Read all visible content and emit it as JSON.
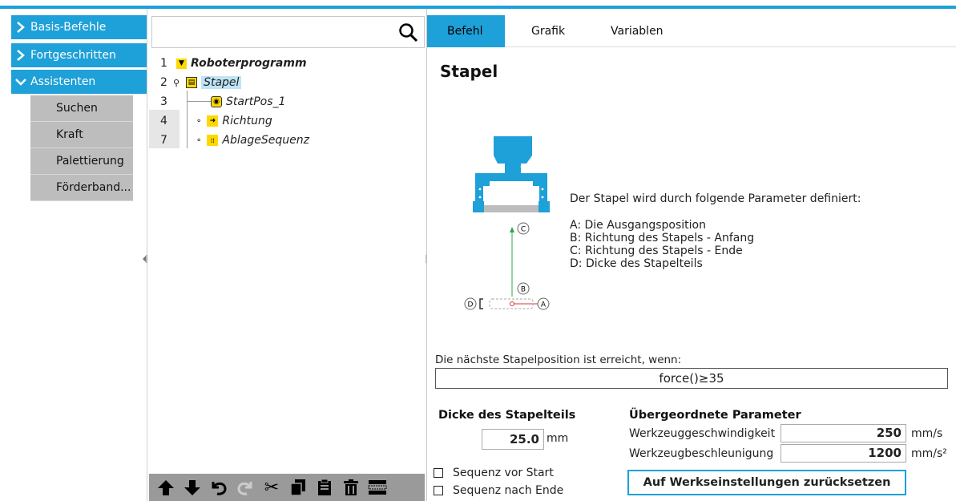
{
  "sidebar": {
    "categories": [
      {
        "label": "Basis-Befehle",
        "chevron": "chevron-right-icon"
      },
      {
        "label": "Fortgeschritten",
        "chevron": "chevron-right-icon"
      },
      {
        "label": "Assistenten",
        "chevron": "chevron-down-icon"
      }
    ],
    "wizards": [
      "Suchen",
      "Kraft",
      "Palettierung",
      "Förderband..."
    ]
  },
  "tree": {
    "search_icon": "search-icon",
    "rows": [
      {
        "num": "1",
        "label": "Roboterprogramm",
        "icon": "▼"
      },
      {
        "num": "2",
        "label": "Stapel",
        "icon": "▤"
      },
      {
        "num": "3",
        "label": "StartPos_1",
        "icon": "◉"
      },
      {
        "num": "4",
        "label": "Richtung",
        "icon": "→"
      },
      {
        "num": "7",
        "label": "AblageSequenz",
        "icon": "⋮⋮"
      }
    ],
    "toolbar": [
      "move-up-icon",
      "move-down-icon",
      "undo-icon",
      "redo-icon",
      "cut-icon",
      "copy-icon",
      "paste-icon",
      "delete-icon",
      "suppress-icon"
    ]
  },
  "tabs": [
    "Befehl",
    "Grafik",
    "Variablen"
  ],
  "panel": {
    "title": "Stapel",
    "intro": "Der Stapel wird durch folgende Parameter definiert:",
    "params": [
      "A: Die Ausgangsposition",
      "B: Richtung des Stapels - Anfang",
      "C: Richtung des Stapels - Ende",
      "D: Dicke des Stapelteils"
    ],
    "diagram_letters": {
      "a": "A",
      "b": "B",
      "c": "C",
      "d": "D"
    },
    "condition_label": "Die nächste Stapelposition ist erreicht, wenn:",
    "condition_value": "force()≥35",
    "thickness_header": "Dicke des Stapelteils",
    "thickness_value": "25.0",
    "thickness_unit": "mm",
    "parent_header": "Übergeordnete Parameter",
    "tool_speed_label": "Werkzeuggeschwindigkeit",
    "tool_speed_value": "250",
    "tool_speed_unit": "mm/s",
    "tool_accel_label": "Werkzeugbeschleunigung",
    "tool_accel_value": "1200",
    "tool_accel_unit": "mm/s²",
    "seq_before": "Sequenz vor Start",
    "seq_after": "Sequenz nach Ende",
    "reset_label": "Auf Werkseinstellungen zurücksetzen"
  },
  "colors": {
    "accent": "#1ea0d8",
    "icon_yellow": "#ffd800",
    "submenu_gray": "#bdbdbd"
  }
}
